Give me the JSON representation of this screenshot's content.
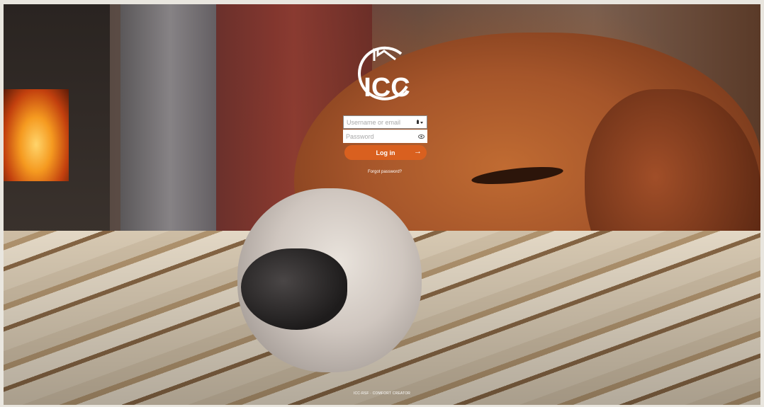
{
  "logo": {
    "text": "ICC"
  },
  "login": {
    "username_placeholder": "Username or email",
    "password_placeholder": "Password",
    "button_label": "Log in",
    "forgot_label": "Forgot password?"
  },
  "footer": {
    "text": "ICC-RSF · COMFORT CREATOR"
  },
  "colors": {
    "accent": "#d9601f"
  },
  "icons": {
    "username": "user-dropdown-icon",
    "password": "eye-icon",
    "button": "arrow-right-icon"
  }
}
